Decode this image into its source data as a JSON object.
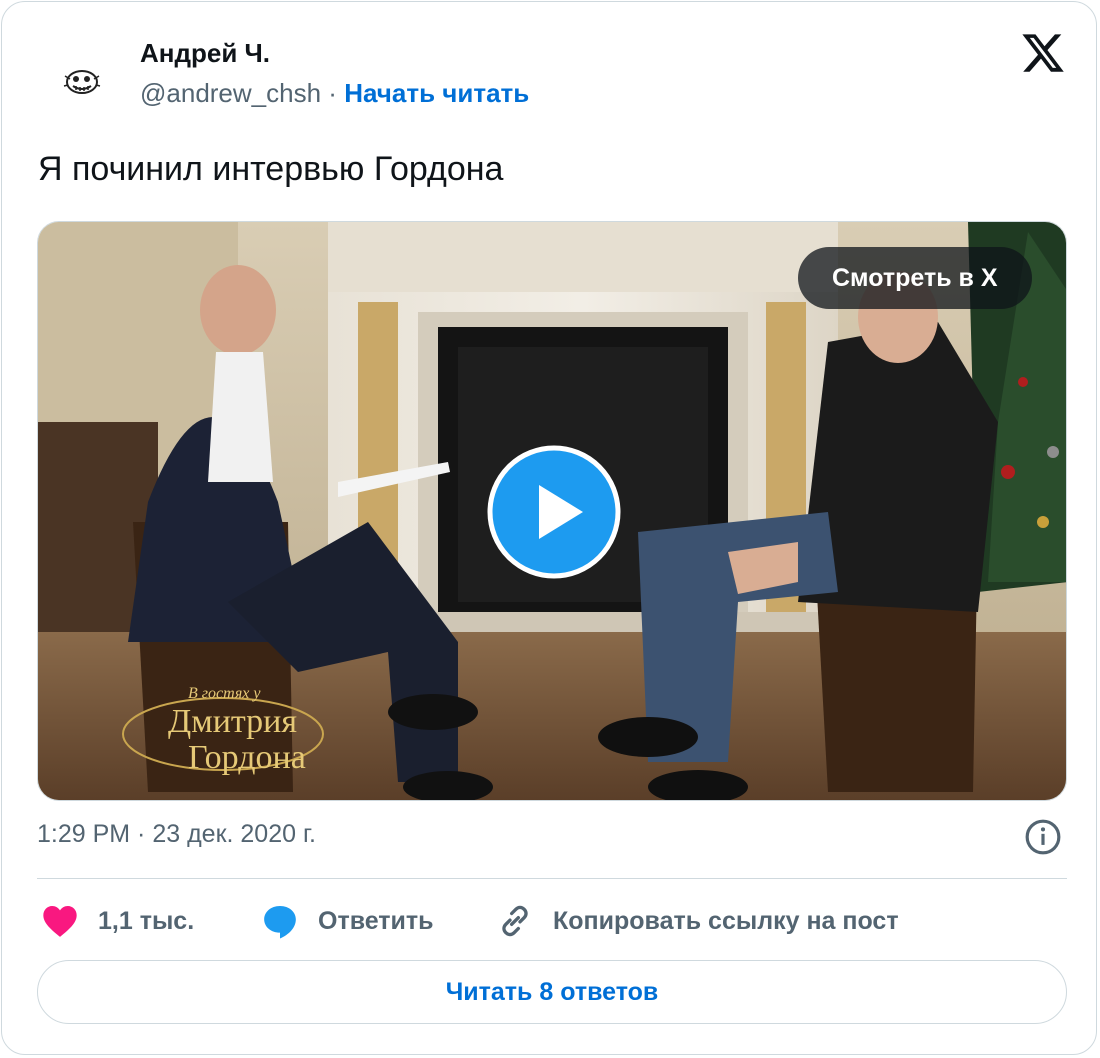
{
  "author": {
    "name": "Андрей Ч.",
    "handle": "@andrew_chsh",
    "separator": "·",
    "follow_label": "Начать читать"
  },
  "tweet": {
    "text": "Я починил интервью Гордона",
    "timestamp": "1:29 PM · 23 дек. 2020 г."
  },
  "media": {
    "watch_label": "Смотреть в X",
    "show_logo": {
      "line1": "В гостях у",
      "line2": "Дмитрия",
      "line3": "Гордона"
    }
  },
  "actions": {
    "likes": "1,1 тыс.",
    "reply_label": "Ответить",
    "copy_label": "Копировать ссылку на пост"
  },
  "read_replies_label": "Читать 8 ответов",
  "colors": {
    "accent": "#006fd6",
    "like": "#f91880",
    "reply": "#1d9bf0",
    "text_primary": "#0f1419",
    "text_secondary": "#536471",
    "border": "#cfd9de"
  },
  "icons": [
    "x-logo-icon",
    "play-icon",
    "info-icon",
    "heart-icon",
    "speech-bubble-icon",
    "link-icon"
  ]
}
